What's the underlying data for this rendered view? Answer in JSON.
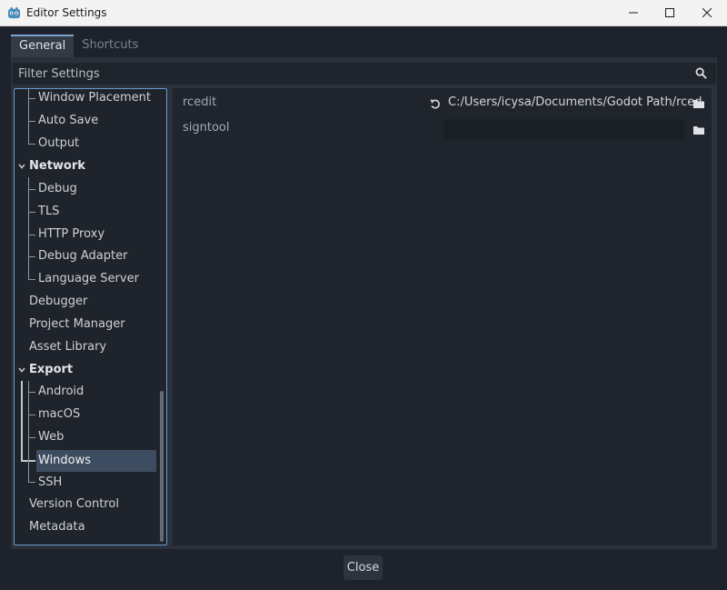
{
  "window": {
    "title": "Editor Settings",
    "controls": {
      "minimize": "minimize-icon",
      "maximize": "maximize-icon",
      "close": "close-icon"
    }
  },
  "tabs": [
    {
      "label": "General",
      "active": true
    },
    {
      "label": "Shortcuts",
      "active": false
    }
  ],
  "filter": {
    "placeholder": "Filter Settings",
    "value": ""
  },
  "tree": {
    "items": [
      {
        "label": "Window Placement",
        "kind": "child"
      },
      {
        "label": "Auto Save",
        "kind": "child"
      },
      {
        "label": "Output",
        "kind": "child"
      },
      {
        "label": "Network",
        "kind": "section"
      },
      {
        "label": "Debug",
        "kind": "child"
      },
      {
        "label": "TLS",
        "kind": "child"
      },
      {
        "label": "HTTP Proxy",
        "kind": "child"
      },
      {
        "label": "Debug Adapter",
        "kind": "child"
      },
      {
        "label": "Language Server",
        "kind": "child"
      },
      {
        "label": "Debugger",
        "kind": "top"
      },
      {
        "label": "Project Manager",
        "kind": "top"
      },
      {
        "label": "Asset Library",
        "kind": "top"
      },
      {
        "label": "Export",
        "kind": "section"
      },
      {
        "label": "Android",
        "kind": "child"
      },
      {
        "label": "macOS",
        "kind": "child"
      },
      {
        "label": "Web",
        "kind": "child"
      },
      {
        "label": "Windows",
        "kind": "child",
        "selected": true
      },
      {
        "label": "SSH",
        "kind": "child"
      },
      {
        "label": "Version Control",
        "kind": "top"
      },
      {
        "label": "Metadata",
        "kind": "top"
      }
    ]
  },
  "properties": [
    {
      "label": "rcedit",
      "value": "C:/Users/icysa/Documents/Godot Path/rced",
      "modified": true
    },
    {
      "label": "signtool",
      "value": "",
      "modified": false
    }
  ],
  "footer": {
    "close_label": "Close"
  },
  "colors": {
    "accent": "#6b9bd1",
    "selected": "#3d4c60",
    "panel": "#2b313a"
  }
}
